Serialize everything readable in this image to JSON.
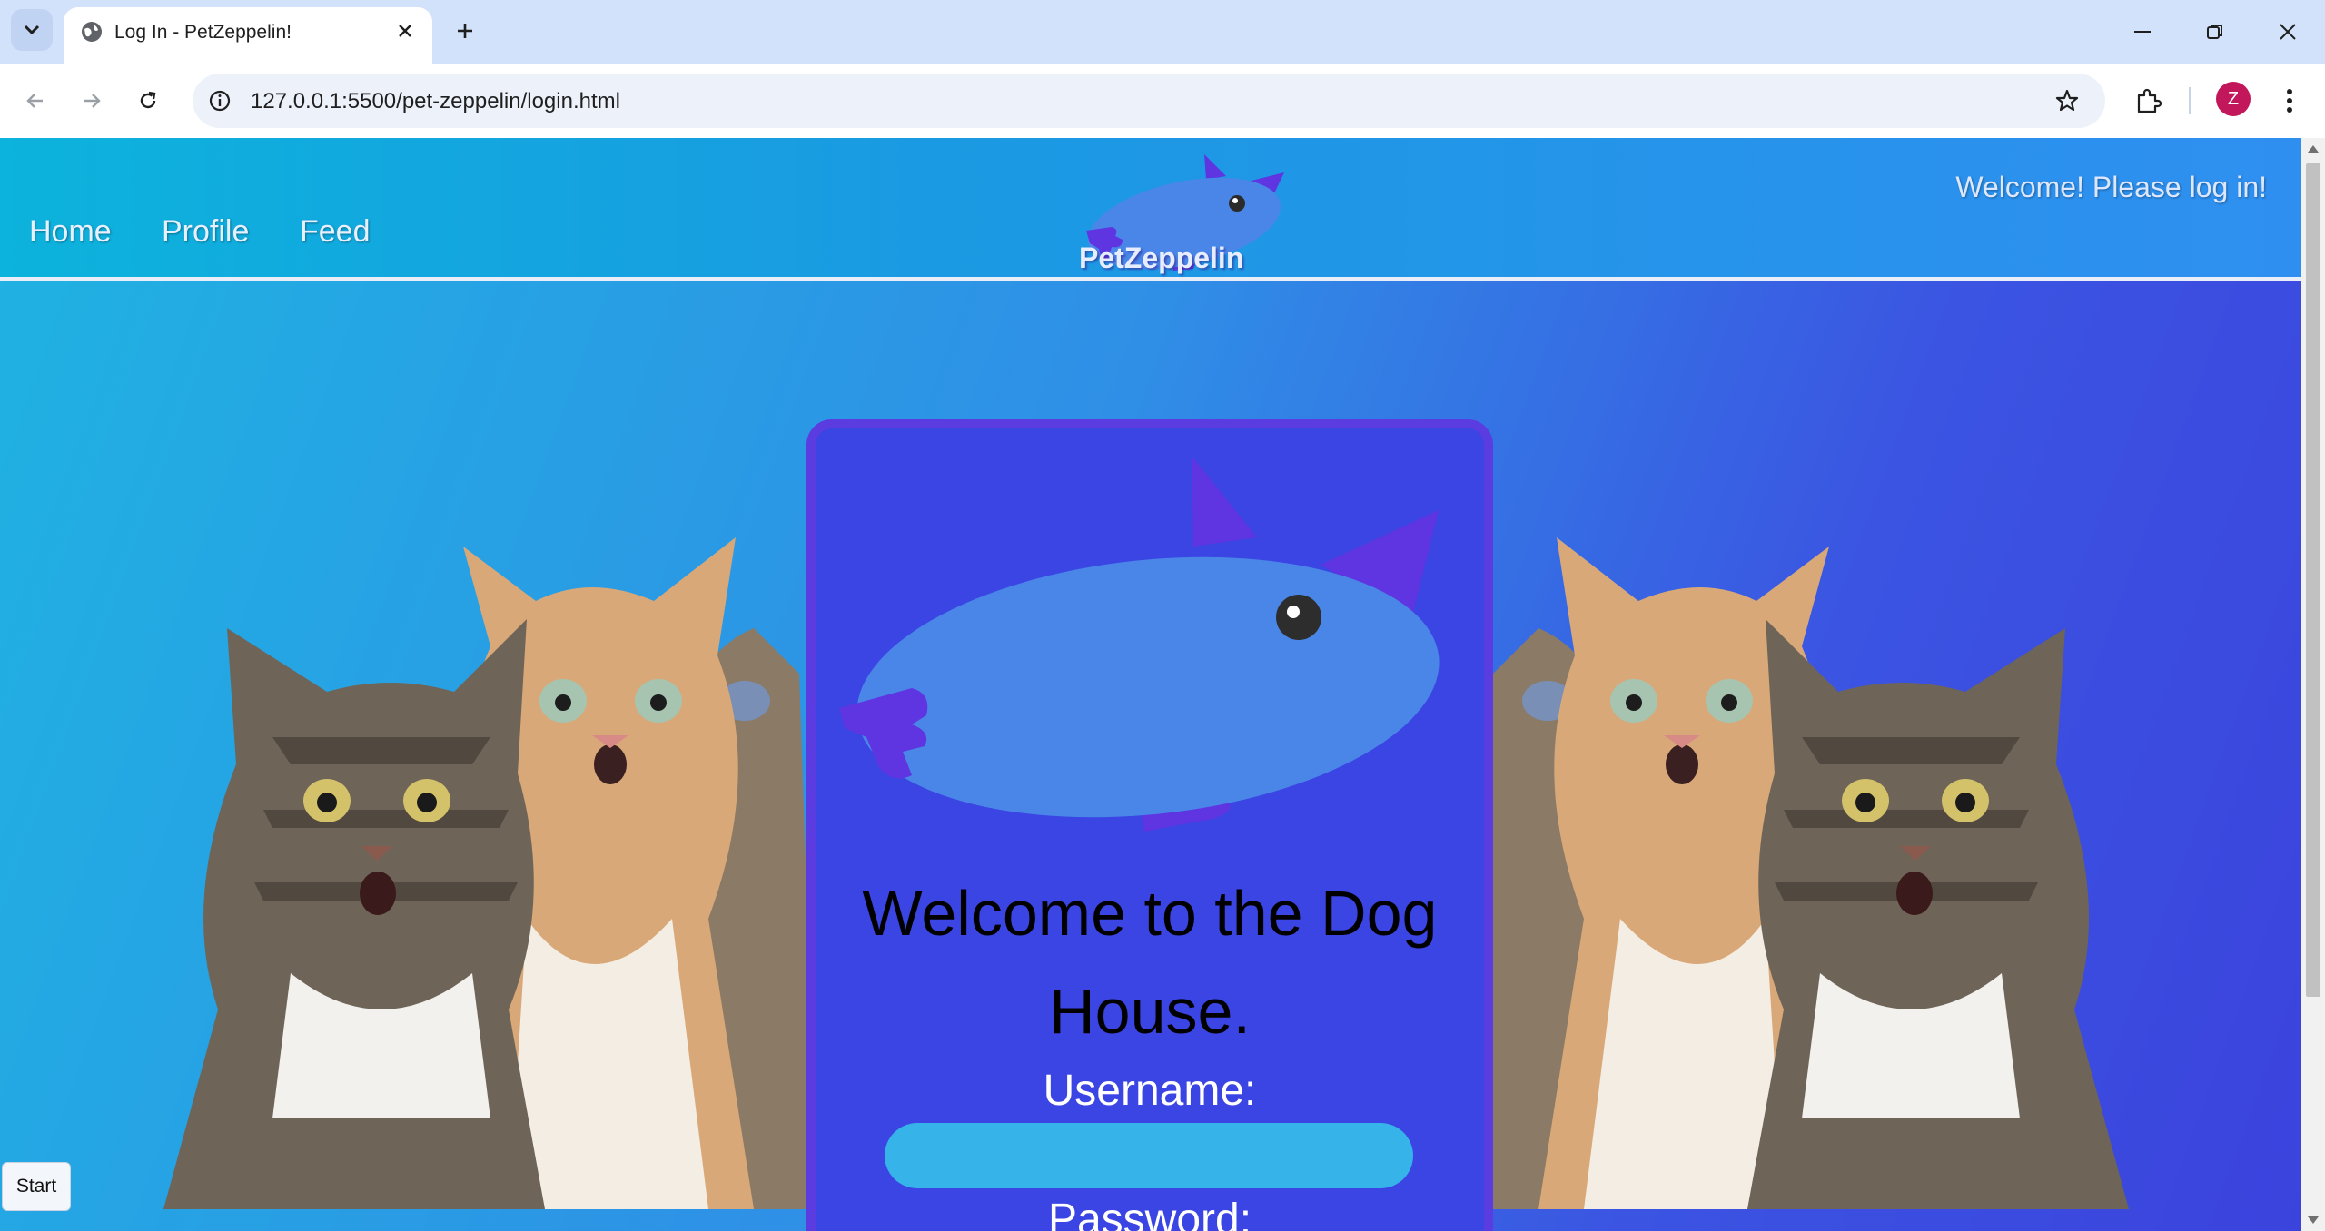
{
  "browser": {
    "tab_title": "Log In - PetZeppelin!",
    "url": "127.0.0.1:5500/pet-zeppelin/login.html",
    "profile_initial": "Z"
  },
  "site": {
    "nav": [
      "Home",
      "Profile",
      "Feed"
    ],
    "logo_text": "PetZeppelin",
    "welcome": "Welcome! Please log in!"
  },
  "login": {
    "heading": "Welcome to the Dog House.",
    "username_label": "Username:",
    "username_value": "",
    "password_label": "Password:"
  },
  "start_button": "Start",
  "colors": {
    "card_bg": "#3a45e3",
    "card_border": "#5b3ce0",
    "input_bg": "#36b3e8",
    "zeppelin_body": "#4a86e8",
    "zeppelin_fin": "#5e35e0"
  }
}
